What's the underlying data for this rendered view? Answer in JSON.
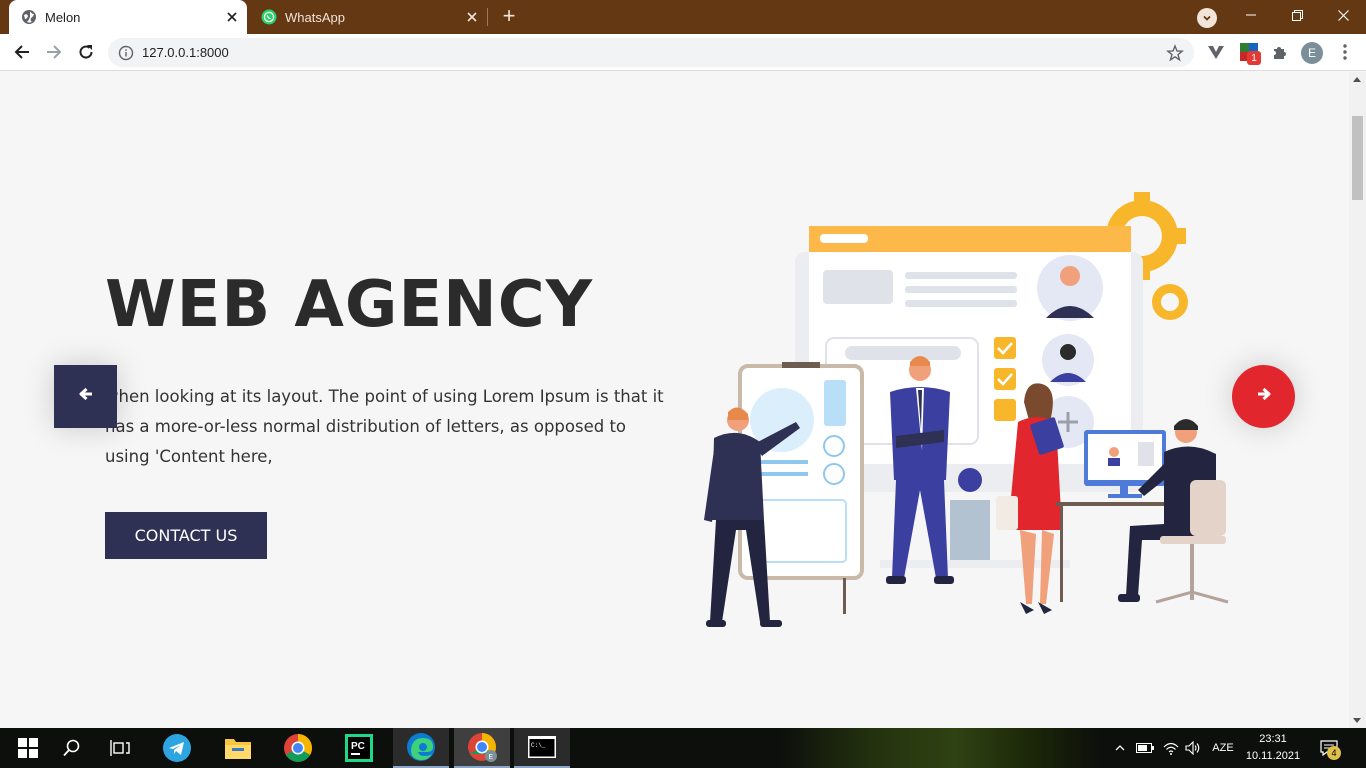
{
  "browser": {
    "tabs": [
      {
        "title": "Melon",
        "active": true
      },
      {
        "title": "WhatsApp",
        "active": false
      }
    ],
    "address": "127.0.0.1:8000",
    "profile_initial": "E",
    "extension_badge": "1"
  },
  "hero": {
    "title": "WEB AGENCY",
    "text": "when looking at its layout. The point of using Lorem Ipsum is that it has a more-or-less normal distribution of letters, as opposed to using 'Content here,",
    "button_label": "CONTACT US"
  },
  "colors": {
    "tab_bar": "#633813",
    "primary": "#2e3154",
    "accent_red": "#e1262e",
    "title": "#2b2b2b"
  },
  "taskbar": {
    "apps": [
      "start-icon",
      "search-icon",
      "task-view-icon",
      "telegram-icon",
      "file-explorer-icon",
      "chrome-icon",
      "pycharm-icon",
      "edge-icon",
      "chrome-profile-icon",
      "terminal-icon"
    ],
    "language": "AZE",
    "time": "23:31",
    "date": "10.11.2021",
    "notification_count": "4"
  }
}
